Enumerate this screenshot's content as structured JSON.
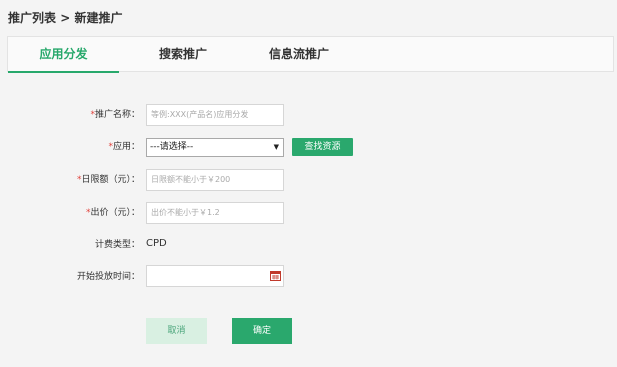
{
  "breadcrumb": {
    "parent": "推广列表",
    "separator": ">",
    "current": "新建推广"
  },
  "tabs": [
    {
      "label": "应用分发",
      "active": true
    },
    {
      "label": "搜索推广",
      "active": false
    },
    {
      "label": "信息流推广",
      "active": false
    }
  ],
  "form": {
    "name": {
      "required_mark": "*",
      "label": "推广名称：",
      "placeholder": "等例:XXX(产品名)应用分发",
      "value": ""
    },
    "app": {
      "required_mark": "*",
      "label": "应用：",
      "selected": "---请选择--",
      "find_button": "查找资源"
    },
    "daily_limit": {
      "required_mark": "*",
      "label": "日限额（元）：",
      "placeholder": "日限额不能小于￥200",
      "value": ""
    },
    "bid": {
      "required_mark": "*",
      "label": "出价（元）：",
      "placeholder": "出价不能小于￥1.2",
      "value": ""
    },
    "billing_type": {
      "label": "计费类型：",
      "value": "CPD"
    },
    "start_time": {
      "label": "开始投放时间：",
      "value": ""
    }
  },
  "actions": {
    "cancel": "取消",
    "confirm": "确定"
  },
  "colors": {
    "accent": "#2aa86d",
    "required": "#e0413b",
    "cancel_bg": "#d9f0e2",
    "background": "#f4f4f4"
  },
  "icons": {
    "select_arrow": "chevron-down-icon",
    "date_picker": "calendar-icon"
  }
}
